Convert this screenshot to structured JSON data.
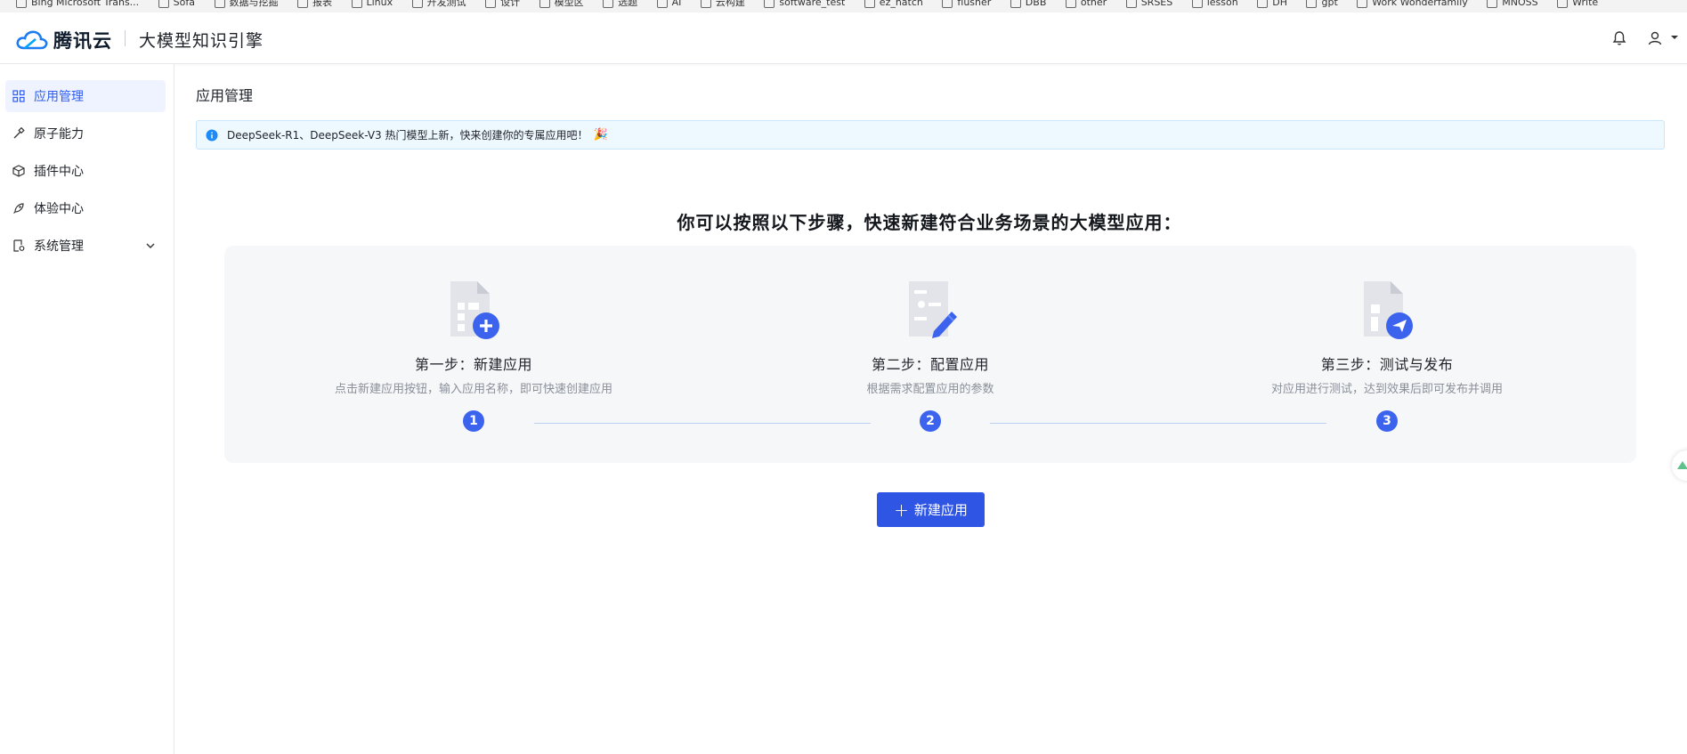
{
  "browser": {
    "bookmarks": [
      "Bing Microsoft Trans...",
      "Sofa",
      "数据与挖掘",
      "报表",
      "Linux",
      "开发测试",
      "设计",
      "模型区",
      "选题",
      "AI",
      "云构建",
      "software_test",
      "ez_hatch",
      "flusher",
      "DBB",
      "other",
      "SRSES",
      "lesson",
      "DH",
      "gpt",
      "Work Wonderfamily",
      "MNOSS",
      "Write"
    ]
  },
  "header": {
    "brand": "腾讯云",
    "product": "大模型知识引擎",
    "bell_icon": "bell-icon",
    "user_icon": "user-icon"
  },
  "sidebar": {
    "items": [
      {
        "label": "应用管理",
        "icon": "grid-icon",
        "active": true
      },
      {
        "label": "原子能力",
        "icon": "wand-icon",
        "active": false
      },
      {
        "label": "插件中心",
        "icon": "cube-icon",
        "active": false
      },
      {
        "label": "体验中心",
        "icon": "rocket-icon",
        "active": false
      },
      {
        "label": "系统管理",
        "icon": "settings-file-icon",
        "active": false,
        "expandable": true
      }
    ]
  },
  "main": {
    "page_title": "应用管理",
    "notice": "DeepSeek-R1、DeepSeek-V3 热门模型上新，快来创建你的专属应用吧！",
    "notice_emoji": "🎉",
    "headline": "你可以按照以下步骤，快速新建符合业务场景的大模型应用：",
    "steps": [
      {
        "num": "1",
        "title": "第一步：新建应用",
        "desc": "点击新建应用按钮，输入应用名称，即可快速创建应用"
      },
      {
        "num": "2",
        "title": "第二步：配置应用",
        "desc": "根据需求配置应用的参数"
      },
      {
        "num": "3",
        "title": "第三步：测试与发布",
        "desc": "对应用进行测试，达到效果后即可发布并调用"
      }
    ],
    "new_app_button": "新建应用"
  },
  "colors": {
    "accent": "#2f55e4",
    "active_nav_bg": "#eef3ff",
    "notice_bg": "#eef8ff",
    "card_bg": "#f6f7f9"
  }
}
